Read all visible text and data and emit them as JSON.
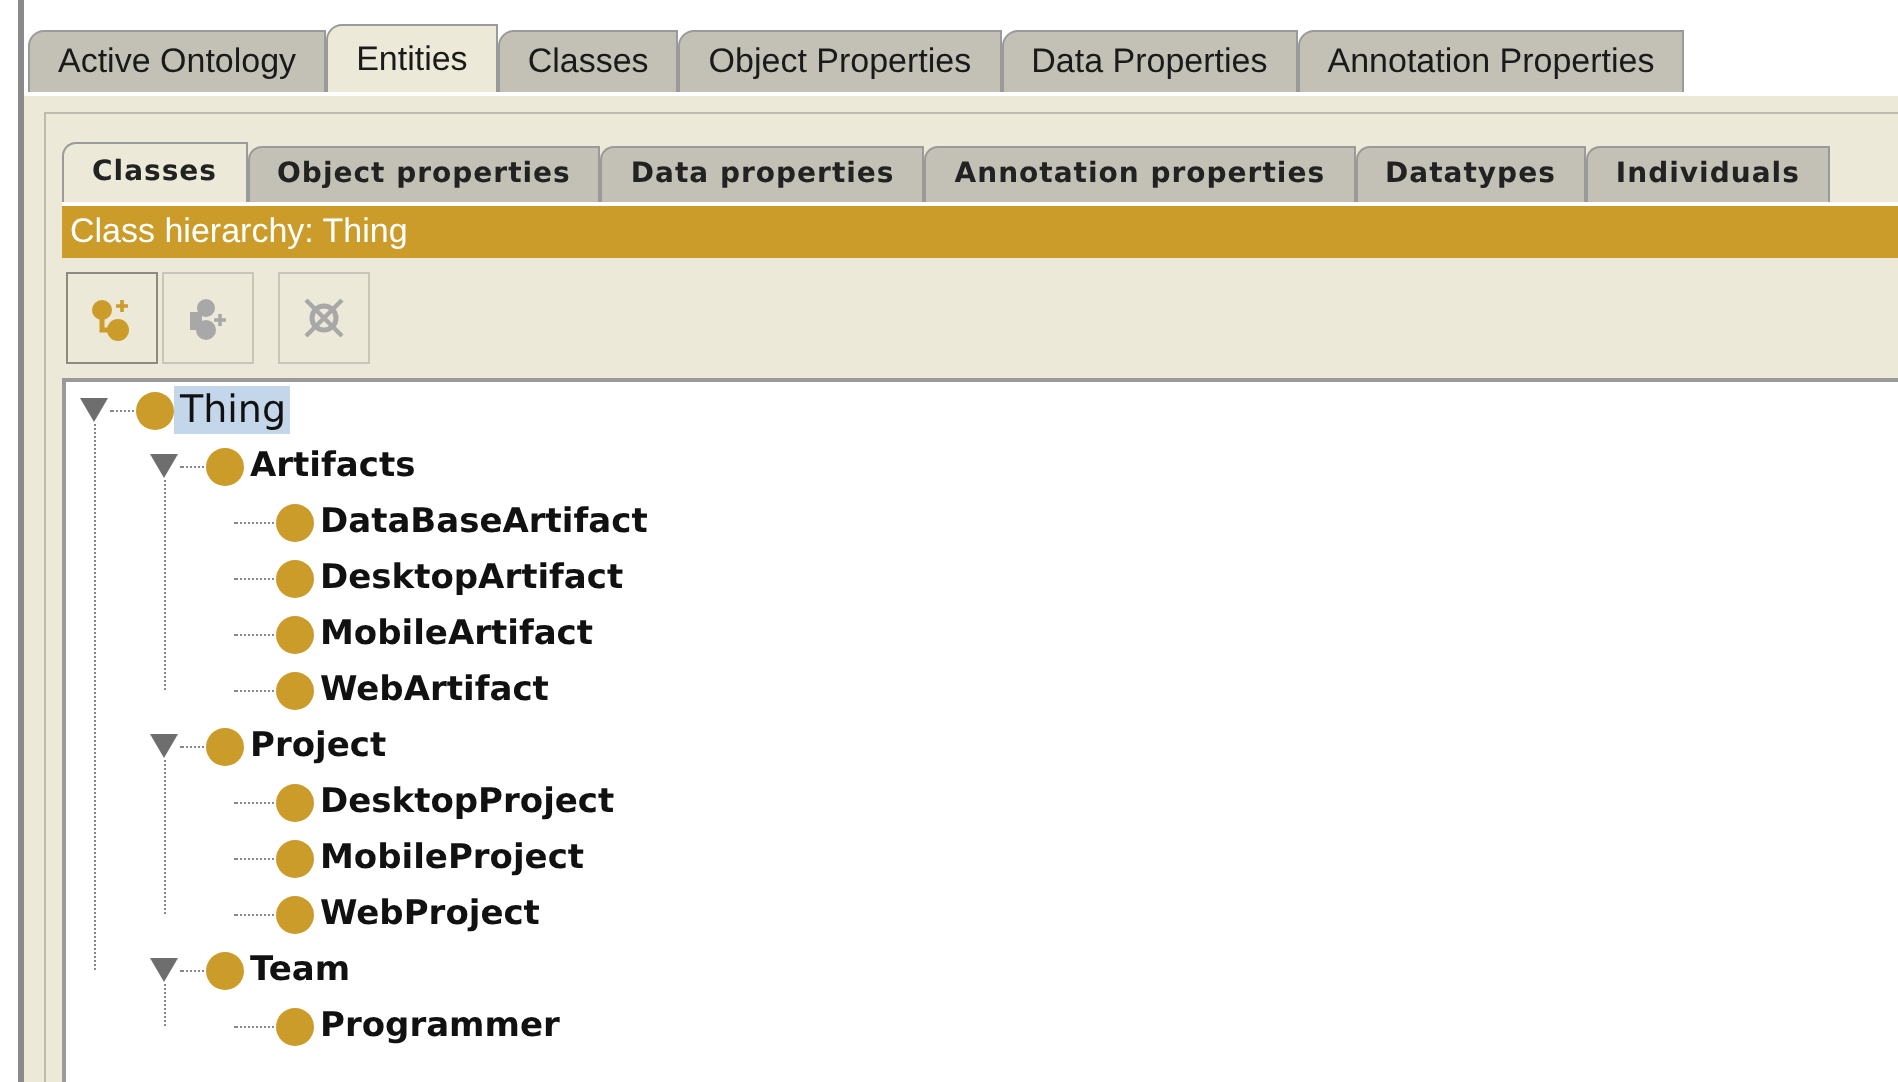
{
  "main_tabs": [
    {
      "label": "Active Ontology",
      "selected": false
    },
    {
      "label": "Entities",
      "selected": true
    },
    {
      "label": "Classes",
      "selected": false
    },
    {
      "label": "Object Properties",
      "selected": false
    },
    {
      "label": "Data Properties",
      "selected": false
    },
    {
      "label": "Annotation Properties",
      "selected": false
    }
  ],
  "sub_tabs": [
    {
      "label": "Classes",
      "selected": true
    },
    {
      "label": "Object properties",
      "selected": false
    },
    {
      "label": "Data properties",
      "selected": false
    },
    {
      "label": "Annotation properties",
      "selected": false
    },
    {
      "label": "Datatypes",
      "selected": false
    },
    {
      "label": "Individuals",
      "selected": false
    }
  ],
  "panel_title": "Class hierarchy: Thing",
  "toolbar": [
    {
      "kind": "add-subclass",
      "disabled": false
    },
    {
      "kind": "add-sibling",
      "disabled": true
    },
    {
      "kind": "delete",
      "disabled": true
    }
  ],
  "tree": [
    {
      "label": "Thing",
      "selected": true,
      "expanded": true,
      "children": [
        {
          "label": "Artifacts",
          "selected": false,
          "expanded": true,
          "children": [
            {
              "label": "DataBaseArtifact",
              "selected": false
            },
            {
              "label": "DesktopArtifact",
              "selected": false
            },
            {
              "label": "MobileArtifact",
              "selected": false
            },
            {
              "label": "WebArtifact",
              "selected": false
            }
          ]
        },
        {
          "label": "Project",
          "selected": false,
          "expanded": true,
          "children": [
            {
              "label": "DesktopProject",
              "selected": false
            },
            {
              "label": "MobileProject",
              "selected": false
            },
            {
              "label": "WebProject",
              "selected": false
            }
          ]
        },
        {
          "label": "Team",
          "selected": false,
          "expanded": true,
          "children": [
            {
              "label": "Programmer",
              "selected": false
            }
          ]
        }
      ]
    }
  ]
}
